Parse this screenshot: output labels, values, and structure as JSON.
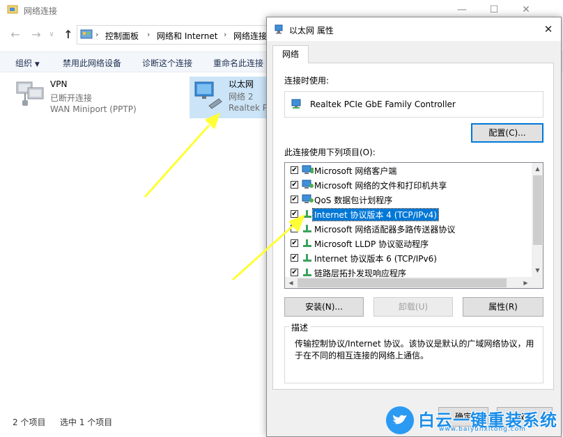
{
  "window": {
    "title": "网络连接",
    "min_glyph": "—",
    "max_glyph": "☐",
    "close_glyph": "✕"
  },
  "nav": {
    "back_glyph": "←",
    "forward_glyph": "→",
    "recent_glyph": "∨",
    "up_glyph": "↑",
    "breadcrumbs": [
      "控制面板",
      "网络和 Internet",
      "网络连接"
    ],
    "separator": "›"
  },
  "toolbar": {
    "organize": "组织",
    "organize_arrow": "▼",
    "disable": "禁用此网络设备",
    "diagnose": "诊断这个连接",
    "rename": "重命名此连接"
  },
  "connections": [
    {
      "name": "VPN",
      "status": "已断开连接",
      "device": "WAN Miniport (PPTP)"
    },
    {
      "name": "以太网",
      "status": "网络 2",
      "device": "Realtek P"
    }
  ],
  "status_bar": {
    "count": "2 个项目",
    "selected": "选中 1 个项目"
  },
  "dialog": {
    "title": "以太网 属性",
    "close_glyph": "✕",
    "tab": "网络",
    "connect_using_label": "连接时使用:",
    "adapter": "Realtek PCIe GbE Family Controller",
    "configure": "配置(C)...",
    "items_label": "此连接使用下列项目(O):",
    "items": [
      {
        "label": "Microsoft 网络客户端",
        "checked": "✔"
      },
      {
        "label": "Microsoft 网络的文件和打印机共享",
        "checked": "✔"
      },
      {
        "label": "QoS 数据包计划程序",
        "checked": "✔"
      },
      {
        "label": "Internet 协议版本 4 (TCP/IPv4)",
        "checked": "✔"
      },
      {
        "label": "Microsoft 网络适配器多路传送器协议",
        "checked": ""
      },
      {
        "label": "Microsoft LLDP 协议驱动程序",
        "checked": "✔"
      },
      {
        "label": "Internet 协议版本 6 (TCP/IPv6)",
        "checked": "✔"
      },
      {
        "label": "链路层拓扑发现响应程序",
        "checked": "✔"
      }
    ],
    "scroll_up": "▲",
    "scroll_down": "▼",
    "scroll_left": "◀",
    "scroll_right": "▶",
    "install": "安装(N)...",
    "uninstall": "卸载(U)",
    "properties": "属性(R)",
    "description_title": "描述",
    "description": "传输控制协议/Internet 协议。该协议是默认的广域网络协议，用于在不同的相互连接的网络上通信。",
    "ok": "确定",
    "cancel": "取消"
  },
  "watermark": {
    "text": "白云一键重装系统",
    "url": "www.baiyunxitong.com"
  },
  "colors": {
    "selection": "#0078d7",
    "highlight_item": "#cce4f7",
    "arrow": "#ffff33",
    "watermark": "#1c8de8"
  }
}
